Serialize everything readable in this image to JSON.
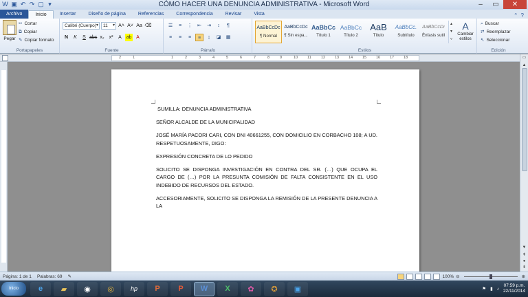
{
  "window": {
    "title": "CÓMO HACER UNA DENUNCIA ADMINISTRATIVA - Microsoft Word",
    "controls": [
      "–",
      "▭",
      "✕"
    ]
  },
  "tabs": [
    {
      "label": "Archivo",
      "kind": "file"
    },
    {
      "label": "Inicio",
      "kind": "active"
    },
    {
      "label": "Insertar",
      "kind": "normal"
    },
    {
      "label": "Diseño de página",
      "kind": "normal"
    },
    {
      "label": "Referencias",
      "kind": "normal"
    },
    {
      "label": "Correspondencia",
      "kind": "normal"
    },
    {
      "label": "Revisar",
      "kind": "normal"
    },
    {
      "label": "Vista",
      "kind": "normal"
    }
  ],
  "ribbon": {
    "clipboard": {
      "paste": "Pegar",
      "cut": "Cortar",
      "copy": "Copiar",
      "format_painter": "Copiar formato",
      "group": "Portapapeles"
    },
    "font": {
      "family": "Calibri (Cuerpo)",
      "size": "11",
      "group": "Fuente"
    },
    "paragraph": {
      "group": "Párrafo"
    },
    "styles": {
      "items": [
        {
          "sample": "AaBbCcDc",
          "name": "¶ Normal",
          "active": true
        },
        {
          "sample": "AaBbCcDc",
          "name": "¶ Sin espa...",
          "active": false
        },
        {
          "sample": "AaBbCc",
          "name": "Título 1",
          "active": false
        },
        {
          "sample": "AaBbCc",
          "name": "Título 2",
          "active": false
        },
        {
          "sample": "AaB",
          "name": "Título",
          "active": false
        },
        {
          "sample": "AaBbCc.",
          "name": "Subtítulo",
          "active": false
        },
        {
          "sample": "AaBbCcDı",
          "name": "Énfasis sutil",
          "active": false
        }
      ],
      "change_styles": "Cambiar estilos",
      "group": "Estilos"
    },
    "editing": {
      "find": "Buscar",
      "replace": "Reemplazar",
      "select": "Seleccionar",
      "group": "Edición"
    }
  },
  "ruler": {
    "numbers": [
      "2",
      "1",
      "1",
      "2",
      "3",
      "4",
      "5",
      "6",
      "7",
      "8",
      "9",
      "10",
      "11",
      "12",
      "13",
      "14",
      "15",
      "16",
      "17",
      "18"
    ]
  },
  "document": {
    "paragraphs": [
      "SUMILLA: DENUNCIA ADMINISTRATIVA",
      "SEÑOR ALCALDE DE LA MUNICIPALIDAD",
      "JOSÉ MARÍA PACORI CARI, CON DNI 40661255, CON DOMICILIO EN CORBACHO 108; A UD. RESPETUOSAMENTE, DIGO:",
      "EXPRESIÓN CONCRETA DE LO PEDIDO",
      "SOLICITO SE DISPONGA INVESTIGACIÓN EN CONTRA DEL SR. (…) QUE OCUPA EL CARGO DE (…) POR LA PRESUNTA COMISIÓN DE FALTA CONSISTENTE EN EL USO INDEBIDO DE RECURSOS DEL ESTADO.",
      "ACCESORIAMENTE, SOLICITO SE DISPONGA LA REMISIÓN DE LA PRESENTE DENUNCIA A LA"
    ]
  },
  "status": {
    "page": "Página: 1 de 1",
    "words": "Palabras: 69",
    "zoom": "100%"
  },
  "taskbar": {
    "start": "Inicio",
    "time": "07:59 p.m.",
    "date": "22/11/2014"
  }
}
